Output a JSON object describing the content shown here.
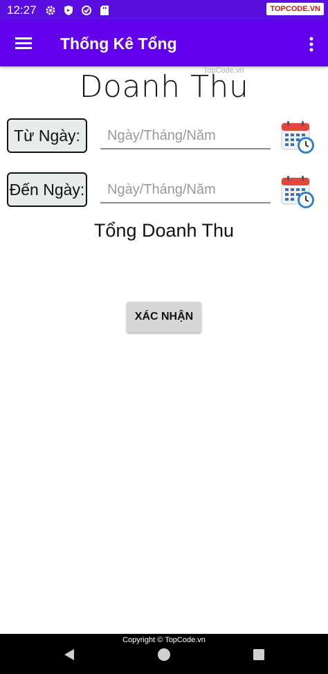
{
  "status_bar": {
    "time": "12:27",
    "icons": [
      "gear-icon",
      "shield-icon",
      "vpn-icon",
      "sd-card-icon"
    ],
    "watermark": "TOPCODE.VN"
  },
  "app_bar": {
    "title": "Thống Kê Tổng",
    "color": "#6200ee"
  },
  "watermark": "TopCode.vn",
  "heading": "Doanh Thu",
  "from": {
    "label": "Từ Ngày:",
    "placeholder": "Ngày/Tháng/Năm",
    "value": ""
  },
  "to": {
    "label": "Đến Ngày:",
    "placeholder": "Ngày/Tháng/Năm",
    "value": ""
  },
  "total_label": "Tổng Doanh Thu",
  "confirm_label": "XÁC NHẬN",
  "nav": {
    "copyright": "Copyright © TopCode.vn"
  }
}
